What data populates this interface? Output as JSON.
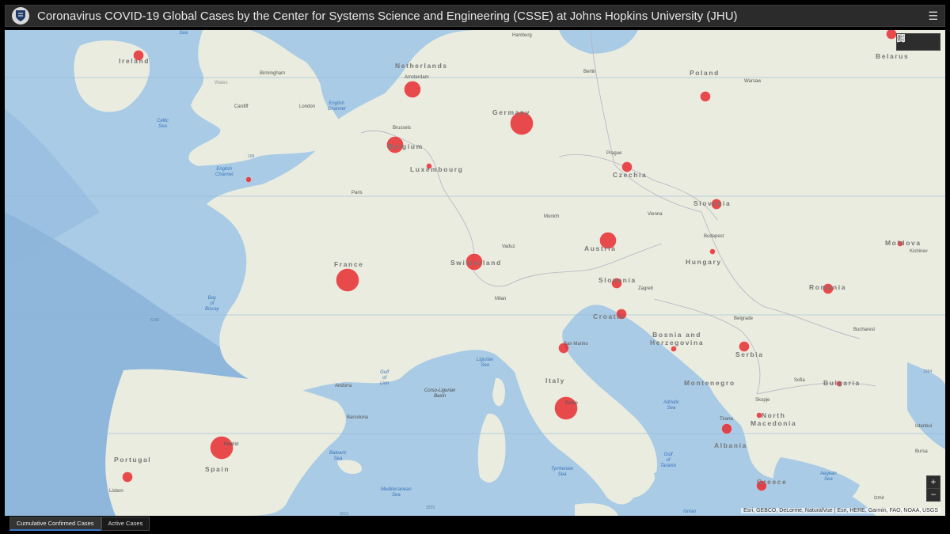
{
  "header": {
    "title": "Coronavirus COVID-19 Global Cases by the Center for Systems Science and Engineering (CSSE) at Johns Hopkins University (JHU)"
  },
  "map": {
    "countries": [
      {
        "id": "ireland",
        "label": "Ireland"
      },
      {
        "id": "netherlands",
        "label": "Netherlands"
      },
      {
        "id": "belgium",
        "label": "Belgium"
      },
      {
        "id": "luxembourg",
        "label": "Luxembourg"
      },
      {
        "id": "germany",
        "label": "Germany"
      },
      {
        "id": "poland",
        "label": "Poland"
      },
      {
        "id": "belarus",
        "label": "Belarus"
      },
      {
        "id": "czechia",
        "label": "Czechia"
      },
      {
        "id": "slovakia",
        "label": "Slovakia"
      },
      {
        "id": "austria",
        "label": "Austria"
      },
      {
        "id": "hungary",
        "label": "Hungary"
      },
      {
        "id": "moldova",
        "label": "Moldova"
      },
      {
        "id": "romania",
        "label": "Romania"
      },
      {
        "id": "france",
        "label": "France"
      },
      {
        "id": "switzerland",
        "label": "Switzerland"
      },
      {
        "id": "slovenia",
        "label": "Slovenia"
      },
      {
        "id": "croatia",
        "label": "Croatia"
      },
      {
        "id": "bosnia",
        "label": "Bosnia and\nHerzegovina"
      },
      {
        "id": "serbia",
        "label": "Serbia"
      },
      {
        "id": "italy",
        "label": "Italy"
      },
      {
        "id": "montenegro",
        "label": "Montenegro"
      },
      {
        "id": "bulgaria",
        "label": "Bulgaria"
      },
      {
        "id": "north-macedonia",
        "label": "North\nMacedonia"
      },
      {
        "id": "albania",
        "label": "Albania"
      },
      {
        "id": "greece",
        "label": "Greece"
      },
      {
        "id": "spain",
        "label": "Spain"
      },
      {
        "id": "portugal",
        "label": "Portugal"
      }
    ],
    "cities": [
      {
        "id": "hamburg",
        "label": "Hamburg"
      },
      {
        "id": "birmingham",
        "label": "Birmingham"
      },
      {
        "id": "amsterdam",
        "label": "Amsterdam"
      },
      {
        "id": "berlin",
        "label": "Berlin"
      },
      {
        "id": "warsaw",
        "label": "Warsaw"
      },
      {
        "id": "wales",
        "label": "Wales"
      },
      {
        "id": "cardiff",
        "label": "Cardiff"
      },
      {
        "id": "london",
        "label": "London"
      },
      {
        "id": "brussels",
        "label": "Brussels"
      },
      {
        "id": "prague",
        "label": "Prague"
      },
      {
        "id": "paris",
        "label": "Paris"
      },
      {
        "id": "munich",
        "label": "Munich"
      },
      {
        "id": "vienna",
        "label": "Vienna"
      },
      {
        "id": "budapest",
        "label": "Budapest"
      },
      {
        "id": "kishinev",
        "label": "Kishinev"
      },
      {
        "id": "vaduz",
        "label": "Vaduz"
      },
      {
        "id": "zagreb",
        "label": "Zagreb"
      },
      {
        "id": "milan",
        "label": "Milan"
      },
      {
        "id": "belgrade",
        "label": "Belgrade"
      },
      {
        "id": "bucharest",
        "label": "Bucharest"
      },
      {
        "id": "san-marino",
        "label": "San Marino"
      },
      {
        "id": "andorra",
        "label": "Andorra"
      },
      {
        "id": "barcelona",
        "label": "Barcelona"
      },
      {
        "id": "sofia",
        "label": "Sofia"
      },
      {
        "id": "skopje",
        "label": "Skopje"
      },
      {
        "id": "tirana",
        "label": "Tirana"
      },
      {
        "id": "istanbul",
        "label": "Istanbul"
      },
      {
        "id": "bursa",
        "label": "Bursa"
      },
      {
        "id": "madrid",
        "label": "Madrid"
      },
      {
        "id": "rome",
        "label": "Rome"
      },
      {
        "id": "lisbon",
        "label": "Lisbon"
      },
      {
        "id": "izmir",
        "label": "Izmir"
      }
    ],
    "seas": [
      {
        "id": "irish-sea",
        "label": "Irish\nSea"
      },
      {
        "id": "celtic-sea",
        "label": "Celtic\nSea"
      },
      {
        "id": "english-channel-1",
        "label": "English\nChannel"
      },
      {
        "id": "english-channel-2",
        "label": "English\nChannel"
      },
      {
        "id": "bay-of-biscay",
        "label": "Bay\nof\nBiscay"
      },
      {
        "id": "ligurian-sea",
        "label": "Ligurian\nSea"
      },
      {
        "id": "gulf-of-lion",
        "label": "Gulf\nof\nLion"
      },
      {
        "id": "corso-ligurian",
        "label": "Corso-Ligurian\nBasin"
      },
      {
        "id": "adriatic-sea",
        "label": "Adriatic\nSea"
      },
      {
        "id": "balearic-sea",
        "label": "Balearic\nSea"
      },
      {
        "id": "tyrrhenian-sea",
        "label": "Tyrrhenian\nSea"
      },
      {
        "id": "mediterranean-sea",
        "label": "Mediterranean\nSea"
      },
      {
        "id": "gulf-of-taranto",
        "label": "Gulf\nof\nTaranto"
      },
      {
        "id": "aegean-sea",
        "label": "Aegean\nSea"
      },
      {
        "id": "ionian",
        "label": "Ionian"
      }
    ],
    "depths": [
      {
        "id": "d168",
        "label": "168"
      },
      {
        "id": "d5142",
        "label": "5142"
      },
      {
        "id": "d3235",
        "label": "3235"
      },
      {
        "id": "d3213",
        "label": "3213"
      },
      {
        "id": "d1884",
        "label": "1884"
      }
    ],
    "case_color": "#e8252b",
    "case_circles": [
      {
        "id": "ireland",
        "size": "small"
      },
      {
        "id": "netherlands",
        "size": "medium"
      },
      {
        "id": "belgium",
        "size": "medium"
      },
      {
        "id": "luxembourg",
        "size": "tiny"
      },
      {
        "id": "germany",
        "size": "large"
      },
      {
        "id": "poland",
        "size": "small"
      },
      {
        "id": "belarus",
        "size": "small"
      },
      {
        "id": "czechia",
        "size": "small"
      },
      {
        "id": "slovakia",
        "size": "small"
      },
      {
        "id": "austria",
        "size": "medium"
      },
      {
        "id": "hungary",
        "size": "tiny"
      },
      {
        "id": "moldova",
        "size": "tiny"
      },
      {
        "id": "romania",
        "size": "small"
      },
      {
        "id": "france",
        "size": "large"
      },
      {
        "id": "switzerland",
        "size": "medium"
      },
      {
        "id": "slovenia",
        "size": "small"
      },
      {
        "id": "croatia",
        "size": "small"
      },
      {
        "id": "bosnia",
        "size": "tiny"
      },
      {
        "id": "serbia",
        "size": "small"
      },
      {
        "id": "san-marino",
        "size": "small"
      },
      {
        "id": "italy",
        "size": "large"
      },
      {
        "id": "bulgaria",
        "size": "tiny"
      },
      {
        "id": "north-macedonia",
        "size": "tiny"
      },
      {
        "id": "albania",
        "size": "small"
      },
      {
        "id": "greece",
        "size": "small"
      },
      {
        "id": "spain",
        "size": "large"
      },
      {
        "id": "portugal",
        "size": "small"
      },
      {
        "id": "uk-channel",
        "size": "tiny"
      }
    ],
    "attribution": "Esri, GEBCO, DeLorme, NaturalVue | Esri, HERE, Garmin, FAO, NOAA, USGS",
    "zoom_in": "+",
    "zoom_out": "−"
  },
  "tabs": [
    {
      "label": "Cumulative Confirmed Cases",
      "active": true
    },
    {
      "label": "Active Cases",
      "active": false
    }
  ]
}
